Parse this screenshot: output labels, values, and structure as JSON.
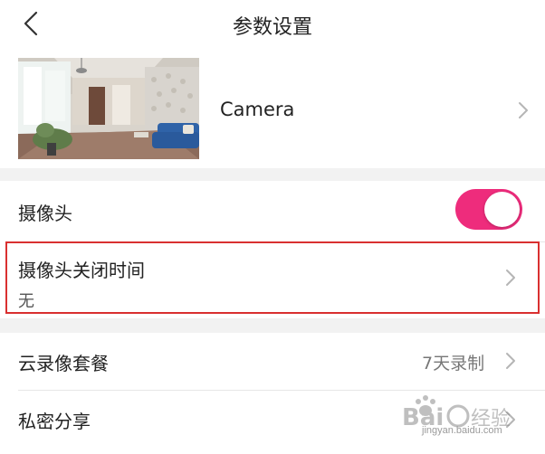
{
  "header": {
    "title": "参数设置",
    "back_icon": "back-arrow-icon"
  },
  "camera": {
    "name": "Camera",
    "thumbnail": "living-room-camera-snapshot"
  },
  "settings": {
    "camera_toggle": {
      "label": "摄像头",
      "enabled": true,
      "color": "#ee2c7c"
    },
    "close_time": {
      "label": "摄像头关闭时间",
      "value": "无"
    }
  },
  "services": {
    "cloud_recording": {
      "label": "云录像套餐",
      "value": "7天录制"
    },
    "private_share": {
      "label": "私密分享"
    }
  },
  "watermark": {
    "brand": "Baidu经验",
    "url": "jingyan.baidu.com"
  },
  "colors": {
    "accent": "#ee2c7c",
    "highlight_border": "#d93030",
    "background": "#f2f2f2"
  }
}
